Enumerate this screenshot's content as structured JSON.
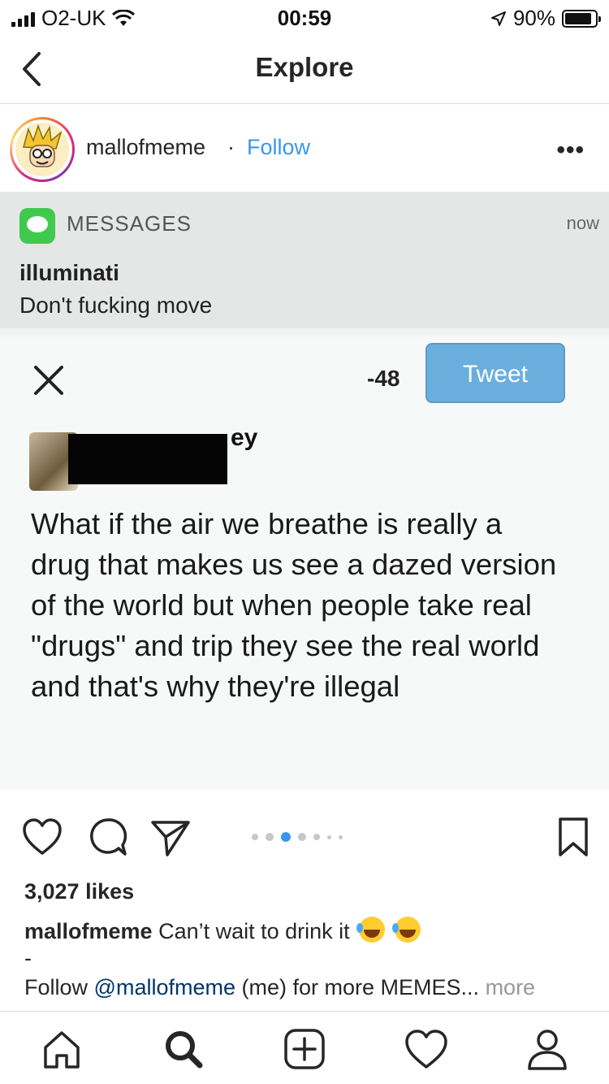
{
  "status_bar": {
    "carrier": "O2-UK",
    "time": "00:59",
    "battery": "90%",
    "battery_level": 0.9
  },
  "nav": {
    "title": "Explore"
  },
  "post": {
    "username": "mallofmeme",
    "separator": "·",
    "follow_label": "Follow",
    "more_label": "•••",
    "image": {
      "notification": {
        "app": "MESSAGES",
        "time": "now",
        "title": "illuminati",
        "body": "Don't fucking move"
      },
      "tweet": {
        "char_count": "-48",
        "button_label": "Tweet",
        "name_tail": "ey",
        "text": "What if the air we breathe is really a drug that makes us see a dazed version of the world but when people take real \"drugs\" and trip they see the real world and that's why they're illegal"
      }
    },
    "carousel": {
      "total": 7,
      "active_index": 2
    },
    "likes": "3,027 likes",
    "caption": {
      "username": "mallofmeme",
      "text": "Can’t wait to drink it",
      "dash": "-",
      "follow_prefix": "Follow",
      "mention": "@mallofmeme",
      "follow_suffix": "(me) for more MEMES...",
      "more_label": "more"
    }
  },
  "colors": {
    "link_blue": "#3897f0",
    "mention_blue": "#003569",
    "divider": "#dbdbdb",
    "tweet_button": "#6aaedd",
    "messages_green": "#3fca4f"
  },
  "icons": {
    "back": "chevron-left-icon",
    "like": "heart-icon",
    "comment": "comment-icon",
    "share": "paper-plane-icon",
    "save": "bookmark-icon",
    "home": "home-icon",
    "search": "search-icon",
    "add": "add-post-icon",
    "activity": "heart-icon",
    "profile": "profile-icon"
  }
}
